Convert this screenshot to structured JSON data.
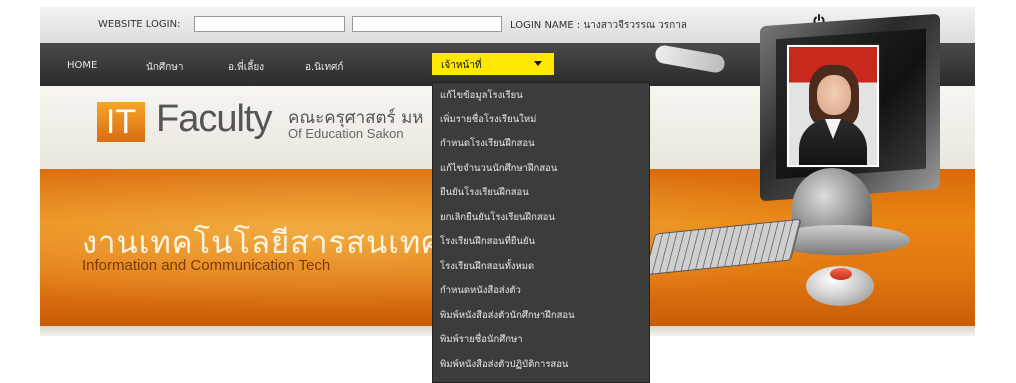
{
  "login": {
    "label": "WEBSITE LOGIN:",
    "username_value": "",
    "password_value": "",
    "login_name": "LOGIN NAME : นางสาวจีรวรรณ วรกาล"
  },
  "nav": {
    "items": [
      {
        "label": "HOME"
      },
      {
        "label": "นักศึกษา"
      },
      {
        "label": "อ.พี่เลี้ยง"
      },
      {
        "label": "อ.นิเทศก์"
      }
    ],
    "active_label": "เจ้าหน้าที่"
  },
  "logo": {
    "it": "IT",
    "faculty": "Faculty",
    "thai": "คณะครุศาสตร์ มห",
    "english": "Of Education Sakon"
  },
  "banner": {
    "title": "งานเทคโนโลยีสารสนเทศ",
    "subtitle": "Information and Communication Tech"
  },
  "dropdown": {
    "items": [
      {
        "label": "แก้ไขข้อมูลโรงเรียน"
      },
      {
        "label": "เพิ่มรายชื่อโรงเรียนใหม่"
      },
      {
        "label": "กำหนดโรงเรียนฝึกสอน"
      },
      {
        "label": "แก้ไขจำนวนนักศึกษาฝึกสอน"
      },
      {
        "label": "ยืนยันโรงเรียนฝึกสอน"
      },
      {
        "label": "ยกเลิกยืนยันโรงเรียนฝึกสอน"
      },
      {
        "label": "โรงเรียนฝึกสอนที่ยืนยัน"
      },
      {
        "label": "โรงเรียนฝึกสอนทั้งหมด"
      },
      {
        "label": "กำหนดหนังสือส่งตัว"
      },
      {
        "label": "พิมพ์หนังสือส่งตัวนักศึกษาฝึกสอน"
      },
      {
        "label": "พิมพ์รายชื่อนักศึกษา"
      },
      {
        "label": "พิมพ์หนังสือส่งตัวปฏิบัติการสอน"
      }
    ]
  },
  "colors": {
    "nav_active": "#ffe800",
    "banner_orange": "#e88513",
    "dropdown_bg": "#3c3c3c"
  }
}
